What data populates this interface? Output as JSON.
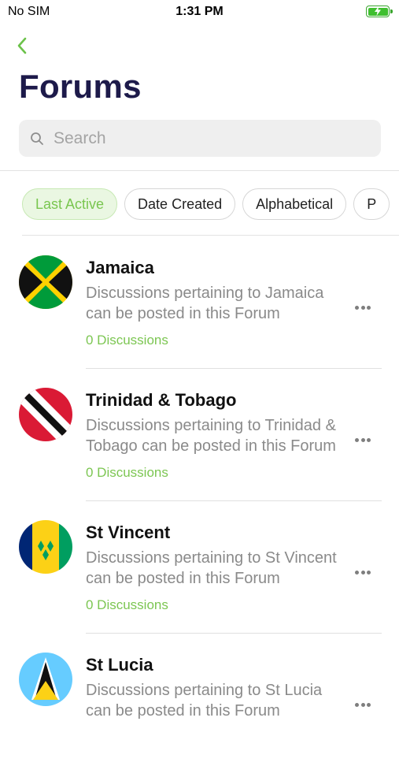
{
  "status_bar": {
    "carrier": "No SIM",
    "time": "1:31 PM"
  },
  "header": {
    "title": "Forums"
  },
  "search": {
    "placeholder": "Search"
  },
  "filters": [
    {
      "label": "Last Active",
      "active": true
    },
    {
      "label": "Date Created",
      "active": false
    },
    {
      "label": "Alphabetical",
      "active": false
    },
    {
      "label": "P",
      "active": false
    }
  ],
  "forums": [
    {
      "name": "Jamaica",
      "description": "Discussions pertaining to Jamaica can be posted in this Forum",
      "count": "0 Discussions",
      "flag_icon": "jamaica-flag-icon"
    },
    {
      "name": "Trinidad & Tobago",
      "description": "Discussions pertaining to Trinidad & Tobago can be posted in this Forum",
      "count": "0 Discussions",
      "flag_icon": "trinidad-tobago-flag-icon"
    },
    {
      "name": "St Vincent",
      "description": "Discussions pertaining to St Vincent can be posted in this Forum",
      "count": "0 Discussions",
      "flag_icon": "st-vincent-flag-icon"
    },
    {
      "name": "St Lucia",
      "description": "Discussions pertaining to St Lucia can be posted in this Forum",
      "count": "",
      "flag_icon": "st-lucia-flag-icon"
    }
  ],
  "colors": {
    "accent": "#7cc652",
    "title": "#1d1a4a"
  }
}
